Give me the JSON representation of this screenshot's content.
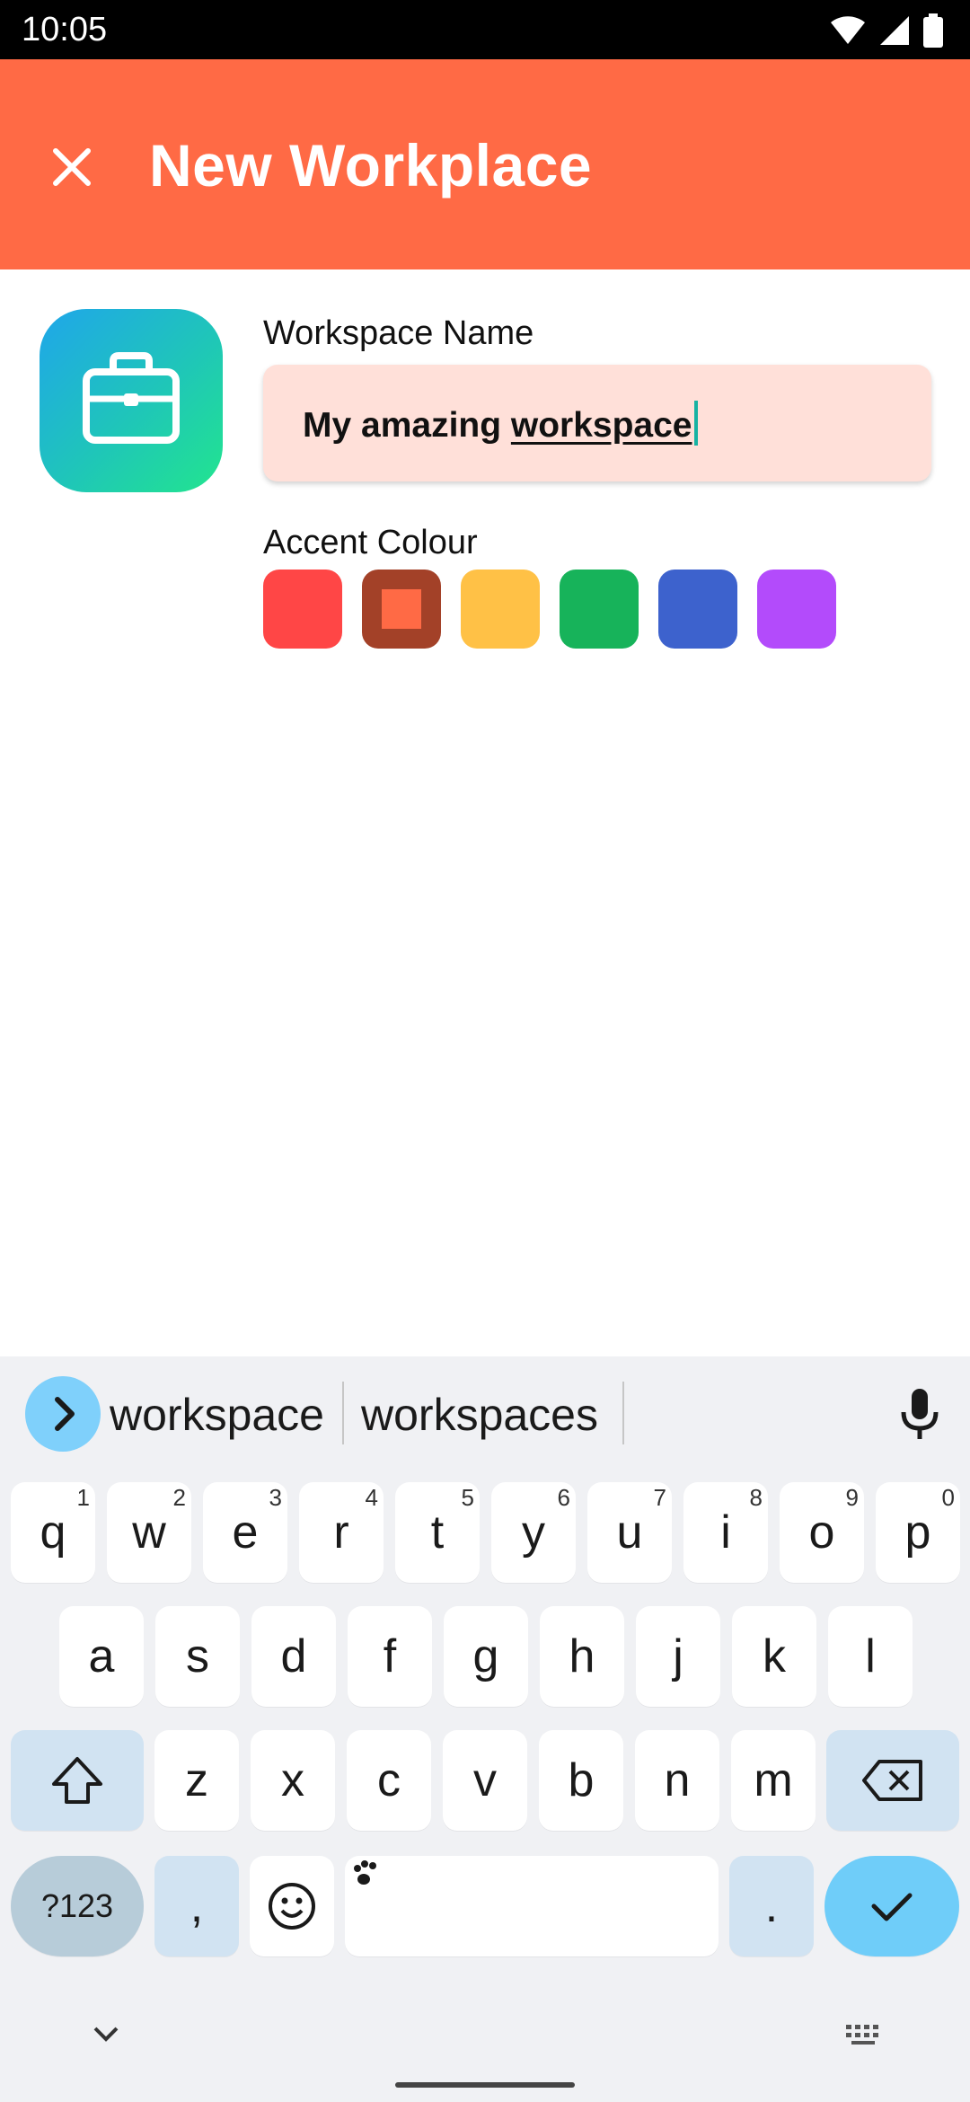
{
  "status_bar": {
    "time": "10:05"
  },
  "app_bar": {
    "title": "New Workplace"
  },
  "form": {
    "name_label": "Workspace Name",
    "name_value_plain": "My amazing ",
    "name_value_underlined": "workspace",
    "accent_label": "Accent Colour",
    "swatches": [
      {
        "color": "#FF4646"
      },
      {
        "color": "#A34128",
        "selected": true
      },
      {
        "color": "#FFC146"
      },
      {
        "color": "#17B35A"
      },
      {
        "color": "#3D62CD"
      },
      {
        "color": "#B34BFB"
      }
    ]
  },
  "keyboard": {
    "suggestions": [
      "workspace",
      "workspaces"
    ],
    "rows": [
      [
        "q",
        "w",
        "e",
        "r",
        "t",
        "y",
        "u",
        "i",
        "o",
        "p"
      ],
      [
        "a",
        "s",
        "d",
        "f",
        "g",
        "h",
        "j",
        "k",
        "l"
      ],
      [
        "z",
        "x",
        "c",
        "v",
        "b",
        "n",
        "m"
      ]
    ],
    "hints": [
      "1",
      "2",
      "3",
      "4",
      "5",
      "6",
      "7",
      "8",
      "9",
      "0"
    ],
    "symbols_label": "?123",
    "comma": ",",
    "period": "."
  }
}
